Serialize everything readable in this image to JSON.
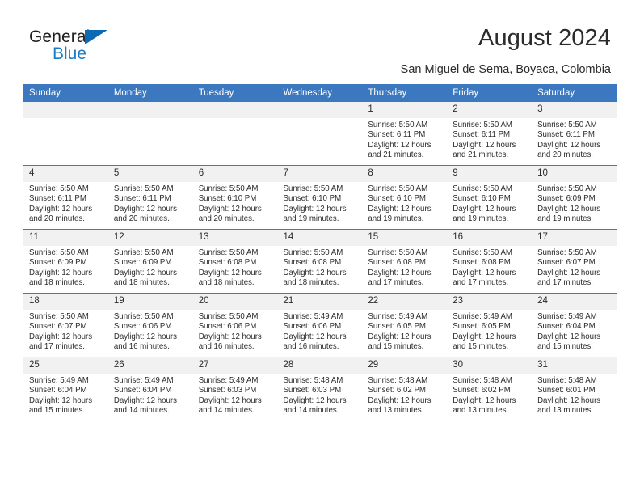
{
  "brand": {
    "name_part1": "General",
    "name_part2": "Blue",
    "accent_color": "#1b7dc4",
    "triangle_color": "#0c69b4"
  },
  "header": {
    "title": "August 2024",
    "subtitle": "San Miguel de Sema, Boyaca, Colombia",
    "header_bg": "#3b78bf"
  },
  "weekday_headers": [
    "Sunday",
    "Monday",
    "Tuesday",
    "Wednesday",
    "Thursday",
    "Friday",
    "Saturday"
  ],
  "weeks": [
    [
      {
        "day": "",
        "empty": true,
        "sunrise": "",
        "sunset": "",
        "daylight1": "",
        "daylight2": ""
      },
      {
        "day": "",
        "empty": true,
        "sunrise": "",
        "sunset": "",
        "daylight1": "",
        "daylight2": ""
      },
      {
        "day": "",
        "empty": true,
        "sunrise": "",
        "sunset": "",
        "daylight1": "",
        "daylight2": ""
      },
      {
        "day": "",
        "empty": true,
        "sunrise": "",
        "sunset": "",
        "daylight1": "",
        "daylight2": ""
      },
      {
        "day": "1",
        "sunrise": "Sunrise: 5:50 AM",
        "sunset": "Sunset: 6:11 PM",
        "daylight1": "Daylight: 12 hours",
        "daylight2": "and 21 minutes."
      },
      {
        "day": "2",
        "sunrise": "Sunrise: 5:50 AM",
        "sunset": "Sunset: 6:11 PM",
        "daylight1": "Daylight: 12 hours",
        "daylight2": "and 21 minutes."
      },
      {
        "day": "3",
        "sunrise": "Sunrise: 5:50 AM",
        "sunset": "Sunset: 6:11 PM",
        "daylight1": "Daylight: 12 hours",
        "daylight2": "and 20 minutes."
      }
    ],
    [
      {
        "day": "4",
        "sunrise": "Sunrise: 5:50 AM",
        "sunset": "Sunset: 6:11 PM",
        "daylight1": "Daylight: 12 hours",
        "daylight2": "and 20 minutes."
      },
      {
        "day": "5",
        "sunrise": "Sunrise: 5:50 AM",
        "sunset": "Sunset: 6:11 PM",
        "daylight1": "Daylight: 12 hours",
        "daylight2": "and 20 minutes."
      },
      {
        "day": "6",
        "sunrise": "Sunrise: 5:50 AM",
        "sunset": "Sunset: 6:10 PM",
        "daylight1": "Daylight: 12 hours",
        "daylight2": "and 20 minutes."
      },
      {
        "day": "7",
        "sunrise": "Sunrise: 5:50 AM",
        "sunset": "Sunset: 6:10 PM",
        "daylight1": "Daylight: 12 hours",
        "daylight2": "and 19 minutes."
      },
      {
        "day": "8",
        "sunrise": "Sunrise: 5:50 AM",
        "sunset": "Sunset: 6:10 PM",
        "daylight1": "Daylight: 12 hours",
        "daylight2": "and 19 minutes."
      },
      {
        "day": "9",
        "sunrise": "Sunrise: 5:50 AM",
        "sunset": "Sunset: 6:10 PM",
        "daylight1": "Daylight: 12 hours",
        "daylight2": "and 19 minutes."
      },
      {
        "day": "10",
        "sunrise": "Sunrise: 5:50 AM",
        "sunset": "Sunset: 6:09 PM",
        "daylight1": "Daylight: 12 hours",
        "daylight2": "and 19 minutes."
      }
    ],
    [
      {
        "day": "11",
        "sunrise": "Sunrise: 5:50 AM",
        "sunset": "Sunset: 6:09 PM",
        "daylight1": "Daylight: 12 hours",
        "daylight2": "and 18 minutes."
      },
      {
        "day": "12",
        "sunrise": "Sunrise: 5:50 AM",
        "sunset": "Sunset: 6:09 PM",
        "daylight1": "Daylight: 12 hours",
        "daylight2": "and 18 minutes."
      },
      {
        "day": "13",
        "sunrise": "Sunrise: 5:50 AM",
        "sunset": "Sunset: 6:08 PM",
        "daylight1": "Daylight: 12 hours",
        "daylight2": "and 18 minutes."
      },
      {
        "day": "14",
        "sunrise": "Sunrise: 5:50 AM",
        "sunset": "Sunset: 6:08 PM",
        "daylight1": "Daylight: 12 hours",
        "daylight2": "and 18 minutes."
      },
      {
        "day": "15",
        "sunrise": "Sunrise: 5:50 AM",
        "sunset": "Sunset: 6:08 PM",
        "daylight1": "Daylight: 12 hours",
        "daylight2": "and 17 minutes."
      },
      {
        "day": "16",
        "sunrise": "Sunrise: 5:50 AM",
        "sunset": "Sunset: 6:08 PM",
        "daylight1": "Daylight: 12 hours",
        "daylight2": "and 17 minutes."
      },
      {
        "day": "17",
        "sunrise": "Sunrise: 5:50 AM",
        "sunset": "Sunset: 6:07 PM",
        "daylight1": "Daylight: 12 hours",
        "daylight2": "and 17 minutes."
      }
    ],
    [
      {
        "day": "18",
        "sunrise": "Sunrise: 5:50 AM",
        "sunset": "Sunset: 6:07 PM",
        "daylight1": "Daylight: 12 hours",
        "daylight2": "and 17 minutes."
      },
      {
        "day": "19",
        "sunrise": "Sunrise: 5:50 AM",
        "sunset": "Sunset: 6:06 PM",
        "daylight1": "Daylight: 12 hours",
        "daylight2": "and 16 minutes."
      },
      {
        "day": "20",
        "sunrise": "Sunrise: 5:50 AM",
        "sunset": "Sunset: 6:06 PM",
        "daylight1": "Daylight: 12 hours",
        "daylight2": "and 16 minutes."
      },
      {
        "day": "21",
        "sunrise": "Sunrise: 5:49 AM",
        "sunset": "Sunset: 6:06 PM",
        "daylight1": "Daylight: 12 hours",
        "daylight2": "and 16 minutes."
      },
      {
        "day": "22",
        "sunrise": "Sunrise: 5:49 AM",
        "sunset": "Sunset: 6:05 PM",
        "daylight1": "Daylight: 12 hours",
        "daylight2": "and 15 minutes."
      },
      {
        "day": "23",
        "sunrise": "Sunrise: 5:49 AM",
        "sunset": "Sunset: 6:05 PM",
        "daylight1": "Daylight: 12 hours",
        "daylight2": "and 15 minutes."
      },
      {
        "day": "24",
        "sunrise": "Sunrise: 5:49 AM",
        "sunset": "Sunset: 6:04 PM",
        "daylight1": "Daylight: 12 hours",
        "daylight2": "and 15 minutes."
      }
    ],
    [
      {
        "day": "25",
        "sunrise": "Sunrise: 5:49 AM",
        "sunset": "Sunset: 6:04 PM",
        "daylight1": "Daylight: 12 hours",
        "daylight2": "and 15 minutes."
      },
      {
        "day": "26",
        "sunrise": "Sunrise: 5:49 AM",
        "sunset": "Sunset: 6:04 PM",
        "daylight1": "Daylight: 12 hours",
        "daylight2": "and 14 minutes."
      },
      {
        "day": "27",
        "sunrise": "Sunrise: 5:49 AM",
        "sunset": "Sunset: 6:03 PM",
        "daylight1": "Daylight: 12 hours",
        "daylight2": "and 14 minutes."
      },
      {
        "day": "28",
        "sunrise": "Sunrise: 5:48 AM",
        "sunset": "Sunset: 6:03 PM",
        "daylight1": "Daylight: 12 hours",
        "daylight2": "and 14 minutes."
      },
      {
        "day": "29",
        "sunrise": "Sunrise: 5:48 AM",
        "sunset": "Sunset: 6:02 PM",
        "daylight1": "Daylight: 12 hours",
        "daylight2": "and 13 minutes."
      },
      {
        "day": "30",
        "sunrise": "Sunrise: 5:48 AM",
        "sunset": "Sunset: 6:02 PM",
        "daylight1": "Daylight: 12 hours",
        "daylight2": "and 13 minutes."
      },
      {
        "day": "31",
        "sunrise": "Sunrise: 5:48 AM",
        "sunset": "Sunset: 6:01 PM",
        "daylight1": "Daylight: 12 hours",
        "daylight2": "and 13 minutes."
      }
    ]
  ]
}
